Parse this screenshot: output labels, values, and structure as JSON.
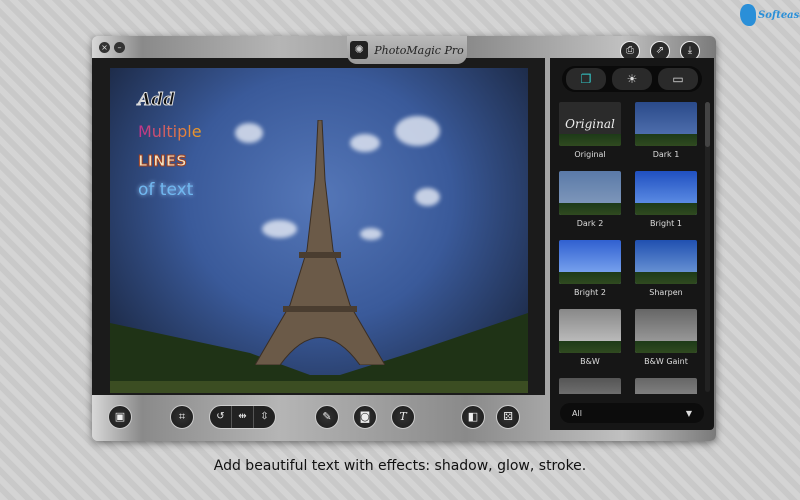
{
  "brand": {
    "logo_text": "Softease"
  },
  "window": {
    "title": "PhotoMagic Pro",
    "close": "×",
    "minimize": "–"
  },
  "header_buttons": [
    {
      "icon": "print-icon",
      "glyph": "⎙"
    },
    {
      "icon": "share-icon",
      "glyph": "⇗"
    },
    {
      "icon": "download-icon",
      "glyph": "⤓"
    }
  ],
  "photo_text": [
    "Add",
    "Multiple",
    "LINES",
    "of text"
  ],
  "panel": {
    "tabs": [
      {
        "icon": "layers-icon",
        "glyph": "❐"
      },
      {
        "icon": "brightness-icon",
        "glyph": "☀"
      },
      {
        "icon": "frame-icon",
        "glyph": "▭"
      }
    ],
    "original_thumb_text": "Original",
    "filters": [
      "Original",
      "Dark 1",
      "Dark 2",
      "Bright 1",
      "Bright 2",
      "Sharpen",
      "B&W",
      "B&W Gaint",
      "",
      ""
    ],
    "dropdown": {
      "value": "All",
      "arrow": "▼"
    }
  },
  "toolbar": [
    {
      "icon": "image-settings-icon",
      "glyph": "▣"
    },
    {
      "icon": "crop-icon",
      "glyph": "⌗"
    },
    {
      "icon": "pencil-icon",
      "glyph": "✎"
    },
    {
      "icon": "vignette-icon",
      "glyph": "◙"
    },
    {
      "icon": "text-icon",
      "glyph": "T"
    },
    {
      "icon": "compare-icon",
      "glyph": "◧"
    },
    {
      "icon": "dice-icon",
      "glyph": "⚄"
    }
  ],
  "transform": [
    {
      "icon": "rotate-icon",
      "glyph": "↺"
    },
    {
      "icon": "flip-horizontal-icon",
      "glyph": "⇹"
    },
    {
      "icon": "flip-vertical-icon",
      "glyph": "⇳"
    }
  ],
  "caption": "Add beautiful text with effects: shadow, glow, stroke."
}
